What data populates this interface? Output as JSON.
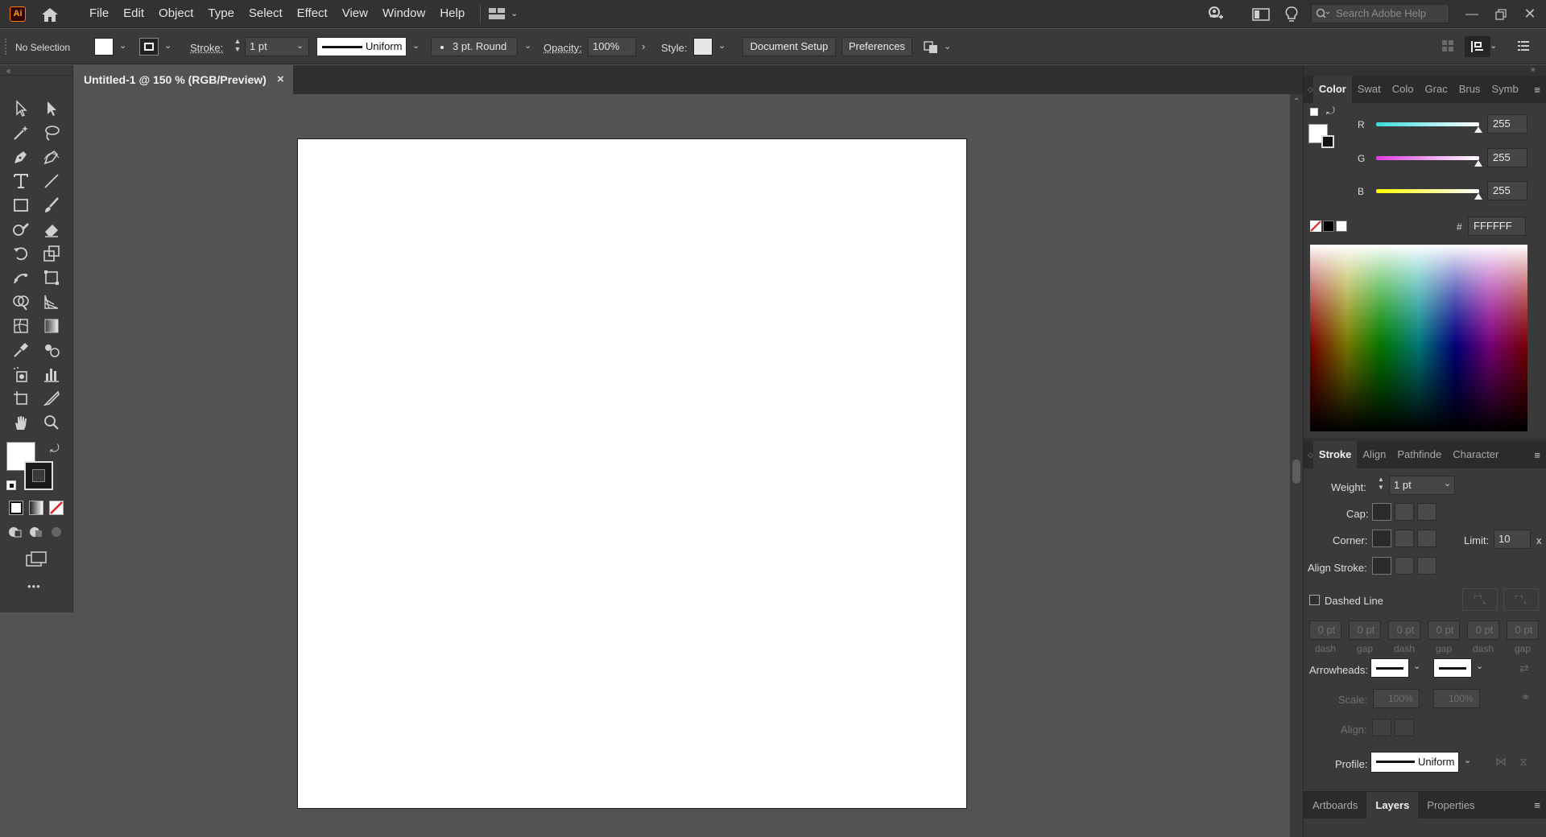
{
  "app": {
    "logo": "Ai"
  },
  "menu": [
    "File",
    "Edit",
    "Object",
    "Type",
    "Select",
    "Effect",
    "View",
    "Window",
    "Help"
  ],
  "search": {
    "placeholder": "Search Adobe Help"
  },
  "control_bar": {
    "selection": "No Selection",
    "stroke_label": "Stroke:",
    "stroke_weight": "1 pt",
    "profile": "Uniform",
    "brush": "3 pt. Round",
    "opacity_label": "Opacity:",
    "opacity": "100%",
    "style_label": "Style:",
    "document_setup": "Document Setup",
    "preferences": "Preferences"
  },
  "document_tab": {
    "title": "Untitled-1 @ 150 % (RGB/Preview)",
    "close": "×"
  },
  "toolbar": {
    "more": "•••"
  },
  "color_panel": {
    "tabs": [
      "Color",
      "Swat",
      "Colo",
      "Grac",
      "Brus",
      "Symb"
    ],
    "active_tab": "Color",
    "r_label": "R",
    "g_label": "G",
    "b_label": "B",
    "r": "255",
    "g": "255",
    "b": "255",
    "hash": "#",
    "hex": "FFFFFF",
    "colors": {
      "r": "#3dd8d8",
      "g": "#e13de1",
      "b": "#ffff00"
    }
  },
  "stroke_panel": {
    "tabs": [
      "Stroke",
      "Align",
      "Pathfinde",
      "Character"
    ],
    "active_tab": "Stroke",
    "weight_label": "Weight:",
    "weight": "1 pt",
    "cap_label": "Cap:",
    "corner_label": "Corner:",
    "limit_label": "Limit:",
    "limit": "10",
    "limit_unit": "x",
    "align_stroke_label": "Align Stroke:",
    "dashed_line_label": "Dashed Line",
    "dash_values": [
      "0 pt",
      "0 pt",
      "0 pt",
      "0 pt",
      "0 pt",
      "0 pt"
    ],
    "dash_labels": [
      "dash",
      "gap",
      "dash",
      "gap",
      "dash",
      "gap"
    ],
    "arrowheads_label": "Arrowheads:",
    "scale_label": "Scale:",
    "scale_start": "100%",
    "scale_end": "100%",
    "align_label": "Align:",
    "profile_label": "Profile:",
    "profile": "Uniform"
  },
  "bottom_tabs": [
    "Artboards",
    "Layers",
    "Properties"
  ],
  "bottom_active": "Layers"
}
